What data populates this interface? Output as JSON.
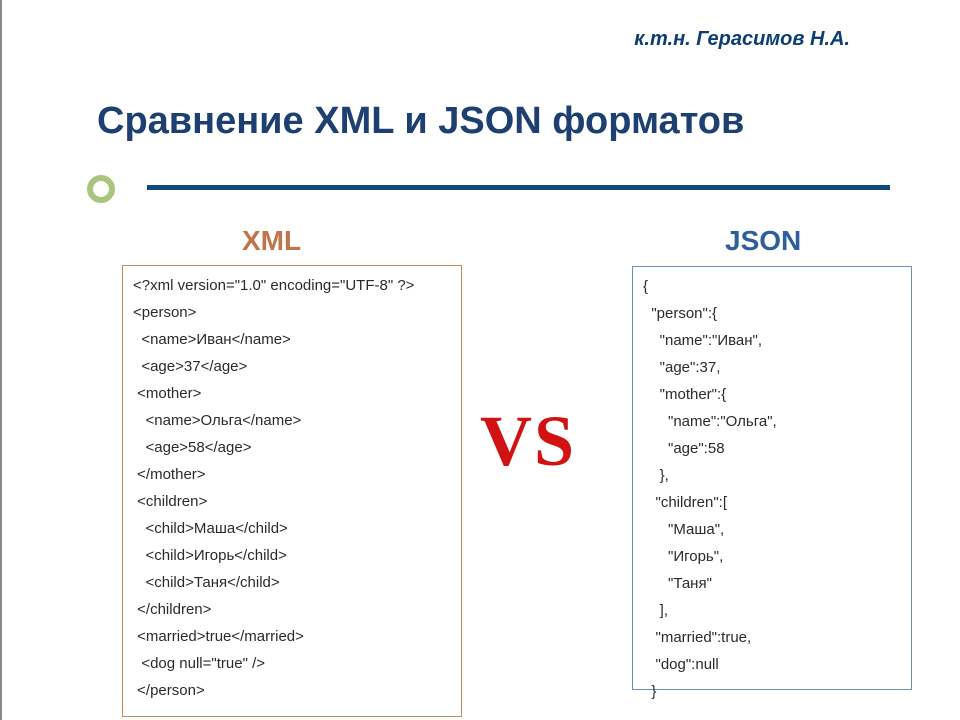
{
  "author": "к.т.н. Герасимов Н.А.",
  "title": "Сравнение XML и JSON форматов",
  "columns": {
    "xml": {
      "heading": "XML"
    },
    "json": {
      "heading": "JSON"
    }
  },
  "vs": "VS",
  "xml_code": "<?xml version=\"1.0\" encoding=\"UTF-8\" ?>\n<person>\n  <name>Иван</name>\n  <age>37</age>\n <mother>\n   <name>Ольга</name>\n   <age>58</age>\n </mother>\n <children>\n   <child>Маша</child>\n   <child>Игорь</child>\n   <child>Таня</child>\n </children>\n <married>true</married>\n  <dog null=\"true\" />\n </person>",
  "json_code": "{\n  \"person\":{\n    \"name\":\"Иван\",\n    \"age\":37,\n    \"mother\":{\n      \"name\":\"Ольга\",\n      \"age\":58\n    },\n   \"children\":[\n      \"Маша\",\n      \"Игорь\",\n      \"Таня\"\n    ],\n   \"married\":true,\n   \"dog\":null\n  }"
}
